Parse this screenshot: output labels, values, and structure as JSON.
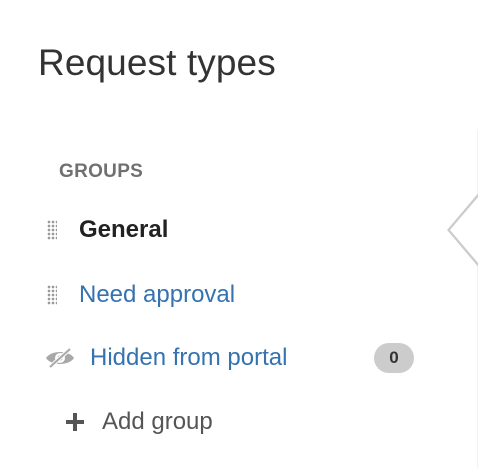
{
  "page": {
    "title": "Request types"
  },
  "groups": {
    "heading": "GROUPS",
    "items": [
      {
        "label": "General",
        "state": "selected",
        "icon": "drag-handle-icon"
      },
      {
        "label": "Need approval",
        "state": "link",
        "icon": "drag-handle-icon"
      },
      {
        "label": "Hidden from portal",
        "state": "link",
        "icon": "hidden-eye-icon",
        "count": "0"
      }
    ],
    "add_label": "Add group",
    "add_icon": "plus-icon"
  },
  "colors": {
    "link": "#3572b0",
    "text": "#333333",
    "heading": "#707070",
    "badge_bg": "#cccccc",
    "border": "#cccccc"
  }
}
